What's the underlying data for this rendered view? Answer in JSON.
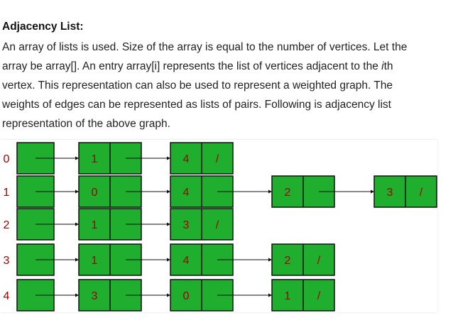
{
  "heading": "Adjacency List:",
  "paragraph": {
    "line1": "An array of lists is used. Size of the array is equal to the number of vertices. Let the",
    "line2_a": "array be array[]. An entry array[i] represents the list of vertices adjacent to the ",
    "line2_i": "i",
    "line2_b": "th",
    "line3": "vertex. This representation can also be used to represent a weighted graph. The",
    "line4": "weights of edges can be represented as lists of pairs. Following is adjacency list",
    "line5": "representation of the above graph."
  },
  "colors": {
    "node_fill": "#1fae2d",
    "node_stroke": "#111111",
    "value_text": "#a30000",
    "index_text": "#a30000"
  },
  "adjacency_list": [
    {
      "index": "0",
      "nodes": [
        {
          "value": "1",
          "null": false
        },
        {
          "value": "4",
          "null": true
        }
      ]
    },
    {
      "index": "1",
      "nodes": [
        {
          "value": "0",
          "null": false
        },
        {
          "value": "4",
          "null": false
        },
        {
          "value": "2",
          "null": false
        },
        {
          "value": "3",
          "null": true
        }
      ]
    },
    {
      "index": "2",
      "nodes": [
        {
          "value": "1",
          "null": false
        },
        {
          "value": "3",
          "null": true
        }
      ]
    },
    {
      "index": "3",
      "nodes": [
        {
          "value": "1",
          "null": false
        },
        {
          "value": "4",
          "null": false
        },
        {
          "value": "2",
          "null": true
        }
      ]
    },
    {
      "index": "4",
      "nodes": [
        {
          "value": "3",
          "null": false
        },
        {
          "value": "0",
          "null": false
        },
        {
          "value": "1",
          "null": true
        }
      ]
    }
  ],
  "null_symbol": "/"
}
